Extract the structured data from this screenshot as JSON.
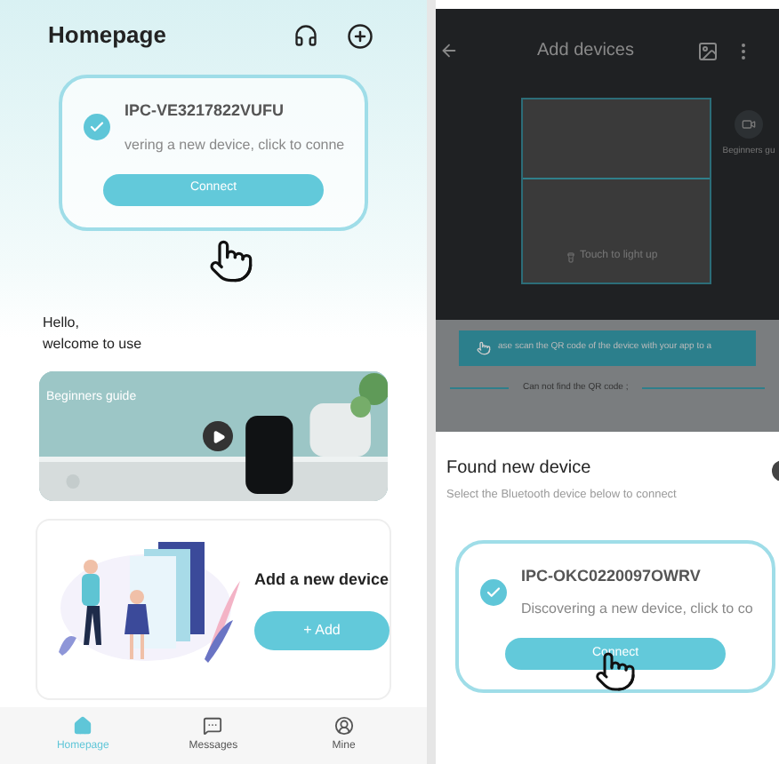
{
  "home": {
    "title": "Homepage",
    "device_card": {
      "name": "IPC-VE3217822VUFU",
      "status": "vering a new device, click to conne",
      "checked": true,
      "button": "Connect"
    },
    "greeting": [
      "Hello,",
      "welcome to use"
    ],
    "guide": {
      "label": "Beginners guide"
    },
    "add_card": {
      "title": "Add a new device",
      "button": "+ Add"
    },
    "nav": [
      {
        "label": "Homepage",
        "selected": true
      },
      {
        "label": "Messages",
        "selected": false
      },
      {
        "label": "Mine",
        "selected": false
      }
    ]
  },
  "scanner": {
    "title": "Add devices",
    "hint": "Touch to light up",
    "side_label": "Beginners gu",
    "banner": "ase scan the QR code of the device with your app to a",
    "link": "Can not find the QR code ;"
  },
  "sheet": {
    "title": "Found new device",
    "subtitle": "Select the Bluetooth device below to connect",
    "device_card": {
      "name": "IPC-OKC0220097OWRV",
      "status": "Discovering a new device, click to co",
      "checked": true,
      "button": "Connect"
    }
  }
}
